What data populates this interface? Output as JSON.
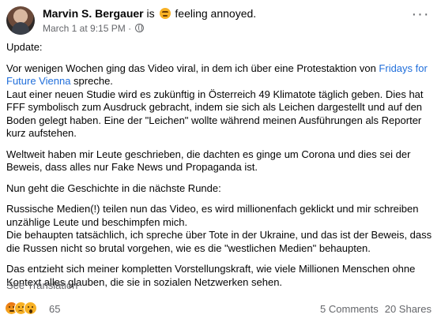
{
  "post": {
    "author": "Marvin S. Bergauer",
    "is_word": "is",
    "mood": "feeling annoyed.",
    "timestamp": "March 1 at 9:15 PM",
    "dot": "·",
    "more_label": "···",
    "paragraphs": {
      "p1": "Update:",
      "p2_before_link": "Vor wenigen Wochen ging das Video viral, in dem ich über eine Protestaktion von ",
      "p2_link": "Fridays for Future Vienna",
      "p2_after_link": " spreche.",
      "p3": " Laut einer neuen Studie wird es zukünftig in Österreich 49 Klimatote täglich geben. Dies hat FFF symbolisch zum Ausdruck gebracht, indem sie sich als Leichen dargestellt und auf den Boden gelegt haben. Eine der \"Leichen\" wollte während meinen Ausführungen als Reporter kurz aufstehen.",
      "p4": "Weltweit haben mir Leute geschrieben, die dachten es ginge um Corona und dies sei der Beweis, dass alles nur Fake News und Propaganda ist.",
      "p5": "Nun geht die Geschichte in die nächste Runde:",
      "p6": "Russische Medien(!) teilen nun das Video, es wird millionenfach geklickt und mir schreiben unzählige Leute und beschimpfen mich.",
      "p7": "Die behaupten tatsächlich, ich spreche über Tote in der Ukraine, und das ist der Beweis, dass die Russen nicht so brutal vorgehen, wie es die \"westlichen Medien\" behaupten.",
      "p8": "Das entzieht sich meiner kompletten Vorstellungskraft, wie viele Millionen Menschen ohne Kontext alles glauben, die sie in sozialen Netzwerken sehen."
    },
    "see_translation": "See Translation",
    "reaction_count": "65",
    "comments": "5 Comments",
    "shares": "20 Shares",
    "reaction_icons": [
      "angry-reaction-icon",
      "sad-reaction-icon",
      "wow-reaction-icon"
    ],
    "link_color": "#216fdb",
    "muted_color": "#65676b"
  }
}
